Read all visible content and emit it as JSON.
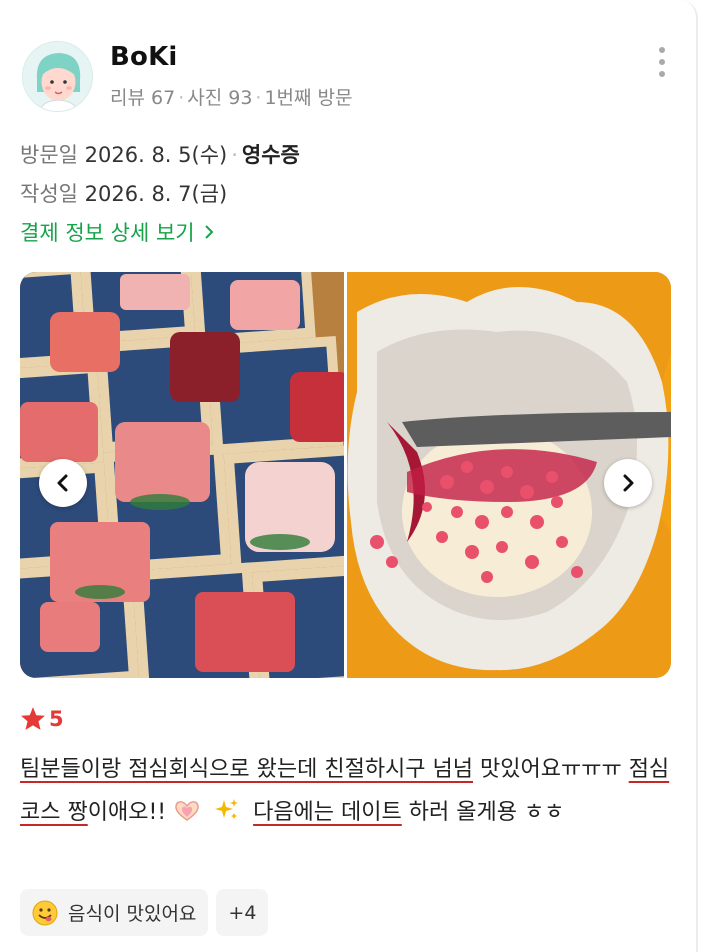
{
  "user": {
    "name": "BoKi",
    "stats": {
      "reviews": "리뷰 67",
      "photos": "사진 93",
      "visit_count": "1번째 방문"
    }
  },
  "visit": {
    "date_label": "방문일",
    "date_value": "2026. 8. 5(수)",
    "receipt_label": "영수증",
    "written_label": "작성일",
    "written_value": "2026. 8. 7(금)"
  },
  "payment_link": "결제 정보 상세 보기",
  "rating": {
    "score": "5"
  },
  "review": {
    "seg1": "팀분들이랑 점심회식으로 왔는데 친절하시구 넘넘",
    "seg2": " 맛있어요ㅠㅠㅠ ",
    "seg3": "점심코스 짱",
    "seg4": "이애오!!",
    "seg5": "다음에는 데이트",
    "seg6": " 하러 올게용 ㅎㅎ"
  },
  "tags": {
    "first": "음식이 맛있어요",
    "more": "+4"
  },
  "colors": {
    "accent_green": "#16a34a",
    "star_red": "#e53935",
    "underline_red": "#c62828"
  },
  "icons": [
    "more-vertical-icon",
    "chevron-right-icon",
    "chevron-left-icon",
    "star-icon",
    "heart-hands-icon",
    "sparkles-icon",
    "smiley-icon"
  ]
}
